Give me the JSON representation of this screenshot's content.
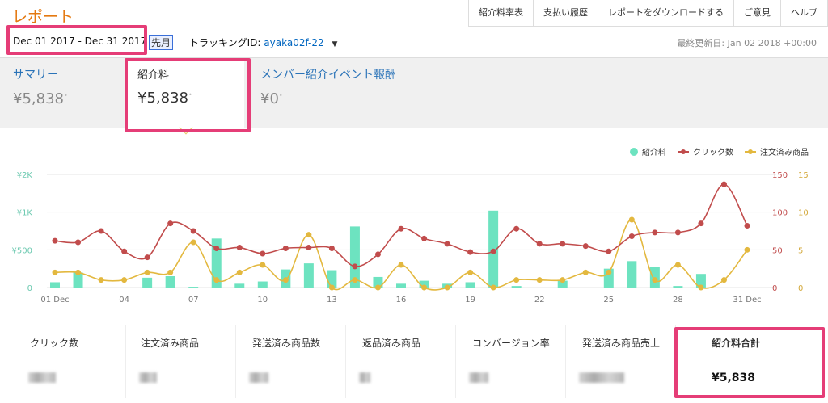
{
  "header": {
    "title": "レポート",
    "links": [
      "紹介料率表",
      "支払い履歴",
      "レポートをダウンロードする",
      "ご意見",
      "ヘルプ"
    ],
    "date_range": "Dec 01 2017 - Dec 31 2017 /",
    "period": "先月",
    "tracking_label": "トラッキングID:",
    "tracking_id": "ayaka02f-22",
    "updated": "最終更新日: Jan 02 2018 +00:00"
  },
  "summary": [
    {
      "label": "サマリー",
      "value": "¥5,838"
    },
    {
      "label": "紹介料",
      "value": "¥5,838"
    },
    {
      "label": "メンバー紹介イベント報酬",
      "value": "¥0"
    }
  ],
  "colors": {
    "accent": "#e47911",
    "link": "#0066c0",
    "highlight": "#e53d77",
    "fee": "#6de3c0",
    "clicks": "#c14c4c",
    "orders": "#e3b83f"
  },
  "chart_data": {
    "type": "bar",
    "x": [
      "01 Dec",
      "02",
      "03",
      "04",
      "05",
      "06",
      "07",
      "08",
      "09",
      "10",
      "11",
      "12",
      "13",
      "14",
      "15",
      "16",
      "17",
      "18",
      "19",
      "20",
      "21",
      "22",
      "23",
      "24",
      "25",
      "26",
      "27",
      "28",
      "29",
      "30",
      "31 Dec"
    ],
    "x_tick_labels": [
      "01 Dec",
      "04",
      "07",
      "10",
      "13",
      "16",
      "19",
      "22",
      "25",
      "28",
      "31 Dec"
    ],
    "left_axis": {
      "ticks": [
        "0",
        "¥500",
        "¥1K",
        "¥2K"
      ],
      "ylim": [
        0,
        1500
      ]
    },
    "right_axis_1": {
      "ticks": [
        "0",
        "50",
        "100",
        "150"
      ],
      "ylim": [
        0,
        150
      ]
    },
    "right_axis_2": {
      "ticks": [
        "0",
        "5",
        "10",
        "15"
      ],
      "ylim": [
        0,
        15
      ]
    },
    "series": [
      {
        "name": "紹介料",
        "type": "bar",
        "axis": "left",
        "values": [
          70,
          200,
          0,
          0,
          130,
          150,
          10,
          650,
          50,
          80,
          240,
          320,
          230,
          810,
          140,
          50,
          90,
          50,
          70,
          1020,
          20,
          0,
          90,
          0,
          250,
          350,
          270,
          20,
          180,
          0,
          0
        ]
      },
      {
        "name": "クリック数",
        "type": "line",
        "axis": "right_axis_1",
        "values": [
          62,
          60,
          75,
          48,
          40,
          85,
          75,
          52,
          53,
          45,
          52,
          53,
          52,
          28,
          44,
          78,
          65,
          58,
          47,
          48,
          78,
          58,
          58,
          55,
          48,
          68,
          73,
          73,
          85,
          137,
          82
        ]
      },
      {
        "name": "注文済み商品",
        "type": "line",
        "axis": "right_axis_2",
        "values": [
          2,
          2,
          1,
          1,
          2,
          2,
          6,
          1,
          2,
          3,
          1,
          7,
          0,
          1,
          0,
          3,
          0,
          0,
          2,
          0,
          1,
          1,
          1,
          2,
          2,
          9,
          1,
          3,
          0,
          1,
          5
        ]
      }
    ],
    "legend_placement": "top-right",
    "grid": true
  },
  "stats": [
    {
      "label": "クリック数"
    },
    {
      "label": "注文済み商品"
    },
    {
      "label": "発送済み商品数"
    },
    {
      "label": "返品済み商品"
    },
    {
      "label": "コンバージョン率"
    },
    {
      "label": "発送済み商品売上"
    },
    {
      "label": "紹介料合計",
      "value": "¥5,838"
    }
  ]
}
